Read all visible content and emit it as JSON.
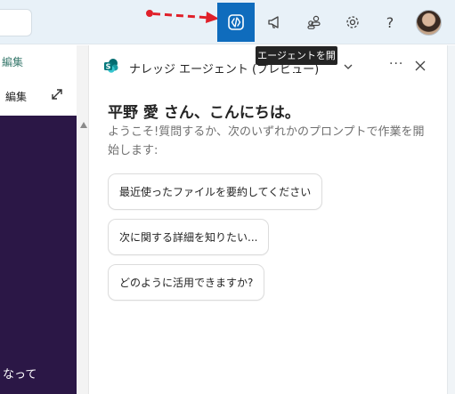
{
  "left": {
    "edit_label_top": "編集",
    "edit_label": "編集",
    "dark_text": "なって"
  },
  "tooltip": {
    "text": "エージェントを開く"
  },
  "panel": {
    "title": "ナレッジ エージェント (プレビュー)",
    "greeting": "平野 愛 さん、こんにちは。",
    "subtitle": "ようこそ!質問するか、次のいずれかのプロンプトで作業を開始します:",
    "prompts": [
      "最近使ったファイルを要約してください",
      "次に関する詳細を知りたい...",
      "どのように活用できますか?"
    ]
  },
  "colors": {
    "active_button": "#0f6cbd",
    "annotation_arrow": "#e0202a",
    "left_dark_bg": "#2b1746"
  },
  "icons": [
    "agent-icon",
    "megaphone-icon",
    "people-icon",
    "gear-icon",
    "help-icon",
    "avatar"
  ]
}
